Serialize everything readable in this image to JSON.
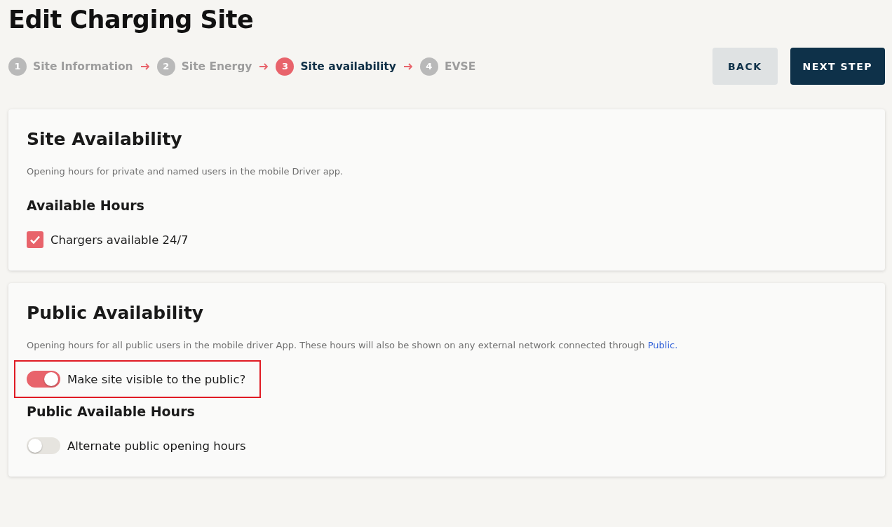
{
  "title": "Edit Charging Site",
  "steps": [
    {
      "number": "1",
      "label": "Site Information",
      "selected": false
    },
    {
      "number": "2",
      "label": "Site Energy",
      "selected": false
    },
    {
      "number": "3",
      "label": "Site availability",
      "selected": true
    },
    {
      "number": "4",
      "label": "EVSE",
      "selected": false
    }
  ],
  "buttons": [
    {
      "label": "BACK",
      "kind": "secondary"
    },
    {
      "label": "NEXT STEP",
      "kind": "primary"
    }
  ],
  "sections": [
    {
      "title": "Site Availability",
      "description": "Opening hours for private and named users in the mobile Driver app.",
      "subtitle": "Available Hours",
      "controls": [
        {
          "kind": "checkbox",
          "label": "Chargers available 24/7",
          "checked": true,
          "highlighted": false
        }
      ]
    },
    {
      "title": "Public Availability",
      "description": "Opening hours for all public users in the mobile driver App. These hours will also be shown on any external network connected through",
      "link": "Public.",
      "controls": [
        {
          "kind": "toggle",
          "label": "Make site visible to the public?",
          "on": true,
          "highlighted": true
        }
      ],
      "subtitle": "Public Available Hours",
      "controls_after": [
        {
          "kind": "toggle",
          "label": "Alternate public opening hours",
          "on": false,
          "highlighted": false
        }
      ]
    }
  ]
}
